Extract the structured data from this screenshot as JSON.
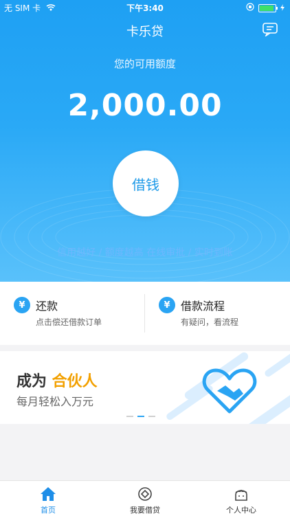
{
  "status_bar": {
    "carrier": "无 SIM 卡",
    "time": "下午3:40"
  },
  "nav": {
    "title": "卡乐贷",
    "message_icon": "message-icon"
  },
  "hero": {
    "limit_label": "您的可用额度",
    "limit_amount": "2,000.00",
    "borrow_button": "借钱",
    "slogan": "信用越好 / 额度越高 在线审批 / 实时到账"
  },
  "quick": {
    "repay": {
      "title": "还款",
      "subtitle": "点击偿还借款订单",
      "icon_char": "¥"
    },
    "process": {
      "title": "借款流程",
      "subtitle": "有疑问，看流程",
      "icon_char": "¥"
    }
  },
  "banner": {
    "line1_prefix": "成为 ",
    "line1_accent": "合伙人",
    "line2": "每月轻松入万元",
    "accent_color": "#f2a000"
  },
  "tabs": [
    {
      "label": "首页",
      "icon": "home-icon",
      "active": true
    },
    {
      "label": "我要借贷",
      "icon": "borrow-icon",
      "active": false
    },
    {
      "label": "个人中心",
      "icon": "profile-icon",
      "active": false
    }
  ],
  "colors": {
    "primary": "#1e9ae8",
    "active_tab": "#1e8ee8"
  }
}
